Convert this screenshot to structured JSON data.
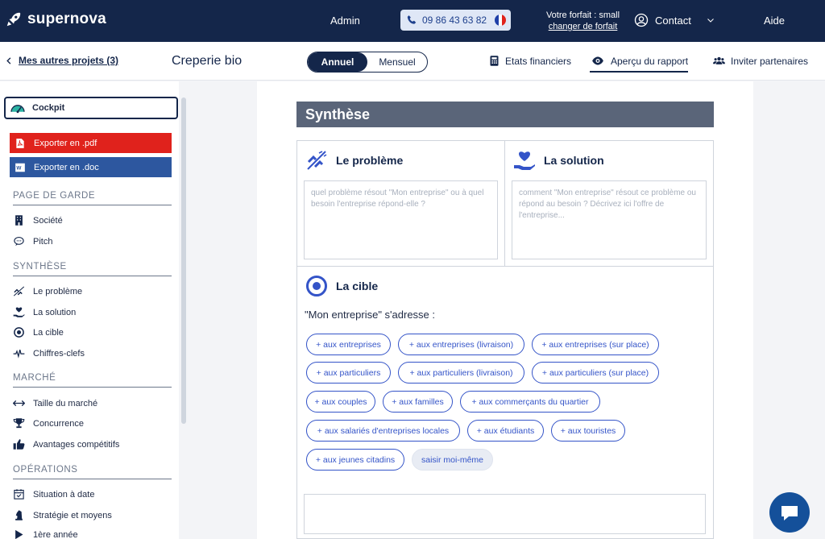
{
  "topbar": {
    "logo_text": "supernova",
    "admin_label": "Admin",
    "phone": "09 86 43 63 82",
    "plan_label": "Votre forfait : small",
    "plan_change": "changer de forfait",
    "contact_label": "Contact",
    "aide_label": "Aide"
  },
  "subbar": {
    "back_label": "Mes autres projets (3)",
    "project_name": "Creperie bio",
    "toggle": {
      "annuel": "Annuel",
      "mensuel": "Mensuel"
    },
    "etats": "Etats financiers",
    "apercu": "Aperçu du rapport",
    "inviter": "Inviter partenaires"
  },
  "sidebar": {
    "cockpit": "Cockpit",
    "export_pdf": "Exporter en .pdf",
    "export_doc": "Exporter en .doc",
    "sections": {
      "page_garde": "PAGE DE GARDE",
      "synthese": "SYNTHÈSE",
      "marche": "MARCHÉ",
      "operations": "OPÉRATIONS"
    },
    "items": {
      "societe": "Société",
      "pitch": "Pitch",
      "probleme": "Le problème",
      "solution": "La solution",
      "cible": "La cible",
      "chiffres": "Chiffres-clefs",
      "taille": "Taille du marché",
      "concurrence": "Concurrence",
      "avantages": "Avantages compétitifs",
      "situation": "Situation à date",
      "strategie": "Stratégie et moyens",
      "annee1": "1ère année"
    }
  },
  "main": {
    "banner": "Synthèse",
    "probleme": {
      "title": "Le problème",
      "placeholder": "quel problème résout \"Mon entreprise\" ou à quel besoin l'entreprise répond-elle ?"
    },
    "solution": {
      "title": "La solution",
      "placeholder": "comment \"Mon entreprise\" résout ce problème ou répond au besoin ? Décrivez ici l'offre de l'entreprise..."
    },
    "cible": {
      "title": "La cible",
      "question": "\"Mon entreprise\" s'adresse :",
      "chips": [
        "+ aux entreprises",
        "+ aux entreprises (livraison)",
        "+ aux entreprises (sur place)",
        "+ aux particuliers",
        "+ aux particuliers (livraison)",
        "+ aux particuliers (sur place)",
        "+ aux couples",
        "+ aux familles",
        "+ aux commerçants du quartier",
        "+ aux salariés d'entreprises locales",
        "+ aux étudiants",
        "+ aux touristes",
        "+ aux jeunes citadins"
      ],
      "custom_chip": "saisir moi-même"
    }
  },
  "colors": {
    "navy": "#14264a",
    "pdf_red": "#e0221c",
    "doc_blue": "#2d579f",
    "chip_blue": "#3454c8",
    "banner_gray": "#5a6579"
  }
}
